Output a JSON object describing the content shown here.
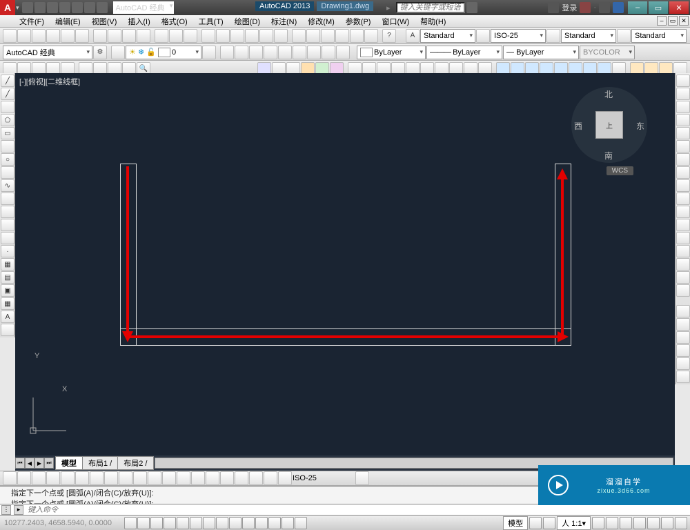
{
  "app": {
    "name": "AutoCAD 2013",
    "doc": "Drawing1.dwg",
    "logo_letter": "A",
    "search_placeholder": "键入关键字或短语",
    "login": "登录"
  },
  "workspace_dropdown": "AutoCAD 经典",
  "menu": [
    "文件(F)",
    "编辑(E)",
    "视图(V)",
    "插入(I)",
    "格式(O)",
    "工具(T)",
    "绘图(D)",
    "标注(N)",
    "修改(M)",
    "参数(P)",
    "窗口(W)",
    "帮助(H)"
  ],
  "style_row": {
    "text_style": "Standard",
    "dim_style": "ISO-25",
    "table_style": "Standard",
    "ml_style": "Standard"
  },
  "layer_row": {
    "workspace": "AutoCAD 经典",
    "layer": "0",
    "color_prop": "ByLayer",
    "linetype": "ByLayer",
    "lineweight": "ByLayer",
    "plotstyle": "BYCOLOR"
  },
  "viewport": {
    "label": "[-][俯视][二维线框]"
  },
  "viewcube": {
    "top": "上",
    "n": "北",
    "s": "南",
    "e": "东",
    "w": "西",
    "wcs": "WCS"
  },
  "ucs": {
    "x": "X",
    "y": "Y"
  },
  "tabs": {
    "model": "模型",
    "layout1": "布局1",
    "layout2": "布局2"
  },
  "dim_dropdown": "ISO-25",
  "command": {
    "history": [
      "指定下一个点或 [圆弧(A)/闭合(C)/放弃(U)]:",
      "指定下一个点或 [圆弧(A)/闭合(C)/放弃(U)]:"
    ],
    "placeholder": "键入命令"
  },
  "status": {
    "coords": "10277.2403, 4658.5940, 0.0000",
    "model_btn": "模型",
    "scale": "1:1",
    "ann": "人"
  },
  "watermark": {
    "brand": "溜溜自学",
    "url": "zixue.3d66.com"
  }
}
